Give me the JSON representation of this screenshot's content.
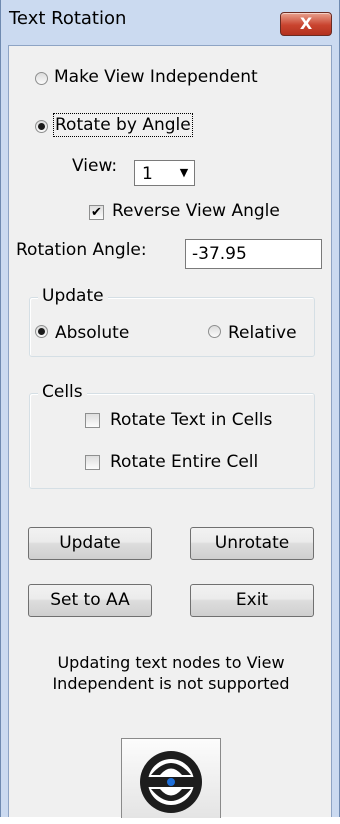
{
  "window": {
    "title": "Text Rotation",
    "close_glyph": "X"
  },
  "mode": {
    "make_view_independent": {
      "label": "Make View Independent",
      "selected": false
    },
    "rotate_by_angle": {
      "label": "Rotate by Angle",
      "selected": true
    }
  },
  "view": {
    "label": "View:",
    "value": "1"
  },
  "reverse_view_angle": {
    "label": "Reverse View Angle",
    "checked": true
  },
  "rotation_angle": {
    "label": "Rotation Angle:",
    "value": "-37.95"
  },
  "update_group": {
    "legend": "Update",
    "absolute": {
      "label": "Absolute",
      "selected": true
    },
    "relative": {
      "label": "Relative",
      "selected": false
    }
  },
  "cells_group": {
    "legend": "Cells",
    "rotate_text": {
      "label": "Rotate Text in Cells",
      "checked": false
    },
    "rotate_entire": {
      "label": "Rotate Entire Cell",
      "checked": false
    }
  },
  "buttons": {
    "update": "Update",
    "unrotate": "Unrotate",
    "set_to_aa": "Set to AA",
    "exit": "Exit"
  },
  "message": "Updating text nodes to View Independent is not supported",
  "icons": {
    "close": "close-icon",
    "logo": "logo-icon",
    "dropdown": "chevron-down-icon"
  },
  "colors": {
    "titlebar": "#cbdaf0",
    "close_button": "#c9442f",
    "dialog_bg": "#f0f0f0",
    "logo_accent": "#1e6fd9"
  }
}
